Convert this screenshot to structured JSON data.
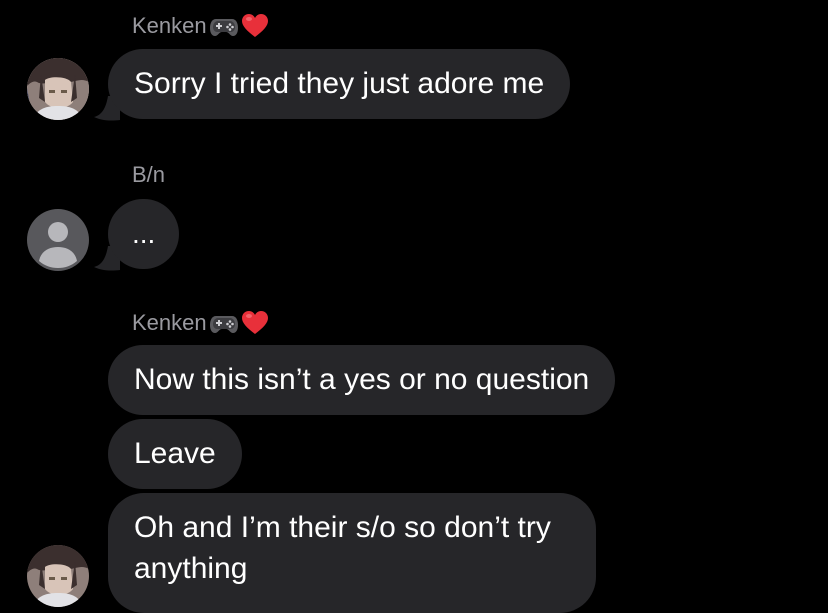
{
  "conversation": {
    "messages": [
      {
        "sender": "Kenken",
        "sender_emojis": [
          "gamepad-emoji",
          "red-heart-emoji"
        ],
        "text": "Sorry I tried they just adore me"
      },
      {
        "sender": "B/n",
        "text": "..."
      },
      {
        "sender": "Kenken",
        "sender_emojis": [
          "gamepad-emoji",
          "red-heart-emoji"
        ],
        "texts": [
          "Now this isn’t a yes or no question",
          "Leave",
          "Oh and I’m their s/o so don’t try anything"
        ]
      }
    ]
  },
  "colors": {
    "background": "#000000",
    "bubble": "#262629",
    "sender_name": "#9a9aa0",
    "message_text": "#ffffff",
    "placeholder_avatar": "#58585c",
    "heart": "#e8303a"
  }
}
